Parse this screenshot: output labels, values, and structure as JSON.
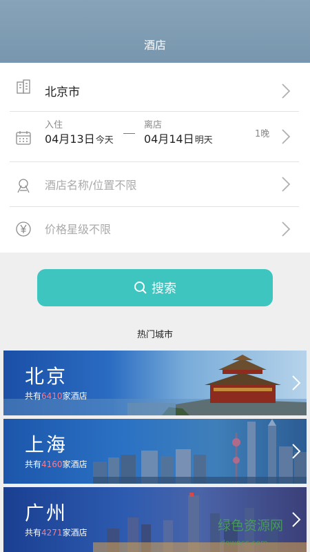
{
  "header": {
    "title": "酒店"
  },
  "form": {
    "city": "北京市",
    "checkin": {
      "label": "入住",
      "date": "04月13日",
      "day": "今天"
    },
    "checkout": {
      "label": "离店",
      "date": "04月14日",
      "day": "明天"
    },
    "nights": "1晚",
    "name_placeholder": "酒店名称/位置不限",
    "price_placeholder": "价格星级不限"
  },
  "search": {
    "label": "搜索"
  },
  "hot_cities": {
    "title": "热门城市",
    "prefix": "共有",
    "suffix": "家酒店",
    "items": [
      {
        "name": "北京",
        "count": "6410"
      },
      {
        "name": "上海",
        "count": "4160"
      },
      {
        "name": "广州",
        "count": "4271"
      }
    ]
  },
  "watermark": {
    "text": "绿色资源网"
  },
  "colors": {
    "header": "#7e9bb2",
    "accent": "#3ec5c0",
    "count_highlight": "#ff7a8a"
  }
}
